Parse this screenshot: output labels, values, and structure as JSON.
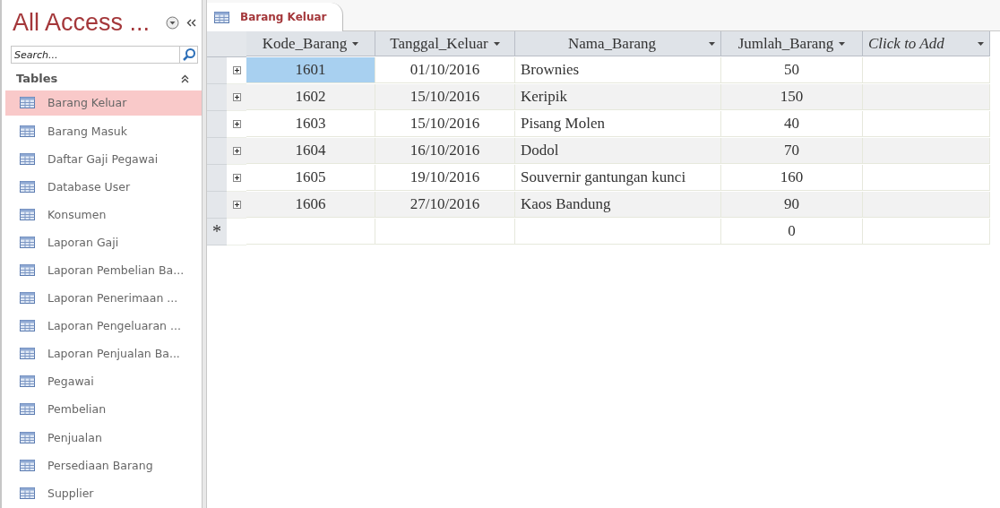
{
  "nav_pane": {
    "title": "All Access ...",
    "search": {
      "placeholder": "Search..."
    },
    "group": {
      "label": "Tables",
      "expanded": true
    },
    "items": [
      {
        "label": "Barang Keluar",
        "selected": true
      },
      {
        "label": "Barang Masuk",
        "selected": false
      },
      {
        "label": "Daftar Gaji Pegawai",
        "selected": false
      },
      {
        "label": "Database User",
        "selected": false
      },
      {
        "label": "Konsumen",
        "selected": false
      },
      {
        "label": "Laporan Gaji",
        "selected": false
      },
      {
        "label": "Laporan Pembelian Ba...",
        "selected": false
      },
      {
        "label": "Laporan Penerimaan ...",
        "selected": false
      },
      {
        "label": "Laporan Pengeluaran ...",
        "selected": false
      },
      {
        "label": "Laporan Penjualan Ba...",
        "selected": false
      },
      {
        "label": "Pegawai",
        "selected": false
      },
      {
        "label": "Pembelian",
        "selected": false
      },
      {
        "label": "Penjualan",
        "selected": false
      },
      {
        "label": "Persediaan Barang",
        "selected": false
      },
      {
        "label": "Supplier",
        "selected": false
      }
    ]
  },
  "tabs": [
    {
      "label": "Barang Keluar",
      "selected": true
    }
  ],
  "table": {
    "columns": [
      {
        "label": "Kode_Barang",
        "kind": "number"
      },
      {
        "label": "Tanggal_Keluar",
        "kind": "date"
      },
      {
        "label": "Nama_Barang",
        "kind": "text"
      },
      {
        "label": "Jumlah_Barang",
        "kind": "number"
      },
      {
        "label": "Click to Add",
        "kind": "add"
      }
    ],
    "rows": [
      {
        "cells": [
          "1601",
          "01/10/2016",
          "Brownies",
          "50"
        ],
        "selected": true
      },
      {
        "cells": [
          "1602",
          "15/10/2016",
          "Keripik",
          "150"
        ],
        "selected": false
      },
      {
        "cells": [
          "1603",
          "15/10/2016",
          "Pisang Molen",
          "40"
        ],
        "selected": false
      },
      {
        "cells": [
          "1604",
          "16/10/2016",
          "Dodol",
          "70"
        ],
        "selected": false
      },
      {
        "cells": [
          "1605",
          "19/10/2016",
          "Souvernir gantungan kunci",
          "160"
        ],
        "selected": false
      },
      {
        "cells": [
          "1606",
          "27/10/2016",
          "Kaos Bandung",
          "90"
        ],
        "selected": false
      }
    ],
    "new_row": {
      "marker": "*",
      "jumlah_barang": "0"
    }
  }
}
